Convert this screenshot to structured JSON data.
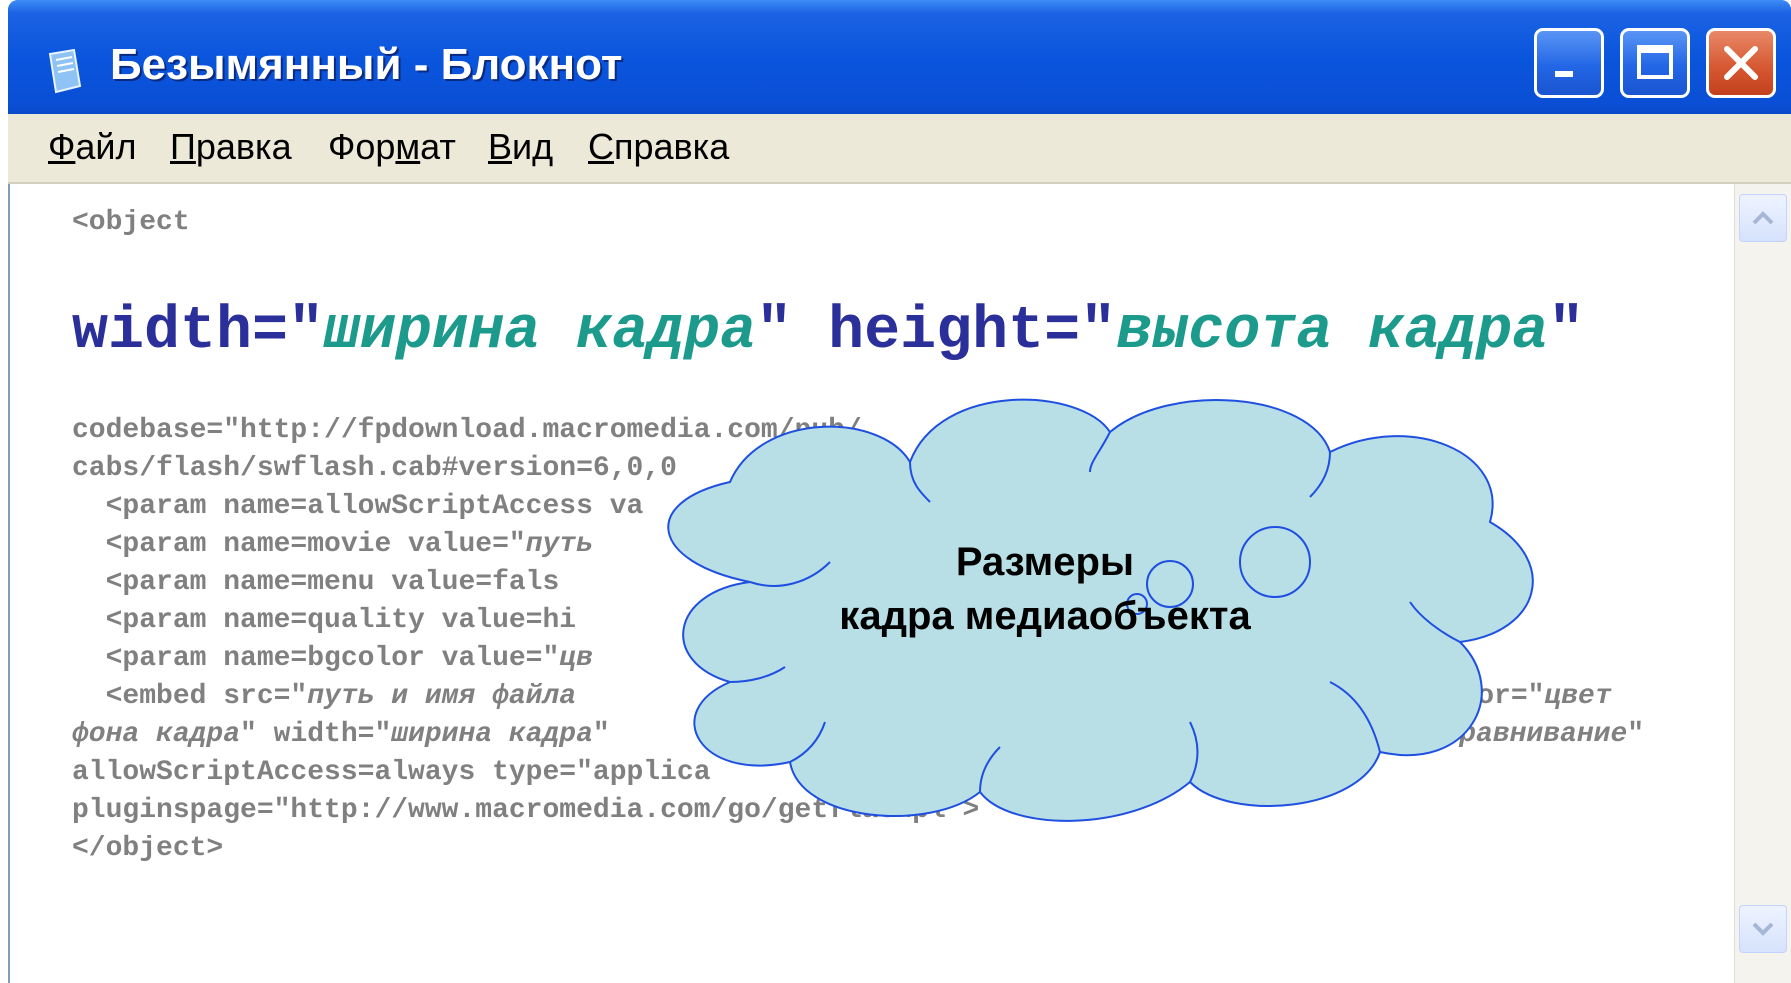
{
  "window": {
    "title": "Безымянный - Блокнот",
    "controls": [
      "minimize",
      "maximize",
      "close"
    ]
  },
  "menu": [
    {
      "label": "Файл",
      "accel": "Ф",
      "rest": "айл"
    },
    {
      "label": "Правка",
      "accel": "П",
      "rest": "равка"
    },
    {
      "label": "Формат",
      "pre": "Фор",
      "accel": "м",
      "rest": "ат"
    },
    {
      "label": "Вид",
      "accel": "В",
      "rest": "ид"
    },
    {
      "label": "Справка",
      "accel": "С",
      "rest": "правка"
    }
  ],
  "editor": {
    "line_object_open": "<object",
    "big_line": {
      "width_attr": "width=\"",
      "width_value": "ширина кадра",
      "height_attr": "\" height=\"",
      "height_value": "высота кадра",
      "end_quote": "\""
    },
    "lines": [
      {
        "id": "l1",
        "parts": [
          {
            "t": "codebase=\"http://fpdownload.macromedia.com/pub/"
          }
        ]
      },
      {
        "id": "l2",
        "parts": [
          {
            "t": "cabs/flash/swflash.cab#version=6,0,0"
          }
        ]
      },
      {
        "id": "l3",
        "parts": [
          {
            "t": "  <param name=allowScriptAccess va"
          }
        ]
      },
      {
        "id": "l4",
        "parts": [
          {
            "t": "  <param name=movie value=\""
          },
          {
            "t": "путь",
            "i": true
          }
        ]
      },
      {
        "id": "l5",
        "parts": [
          {
            "t": "  <param name=menu value=fals"
          }
        ]
      },
      {
        "id": "l6",
        "parts": [
          {
            "t": "  <param name=quality value=hi"
          }
        ]
      },
      {
        "id": "l7",
        "parts": [
          {
            "t": "  <param name=bgcolor value=\""
          },
          {
            "t": "цв",
            "i": true
          }
        ]
      },
      {
        "id": "l8a",
        "parts": [
          {
            "t": "  <embed src=\""
          },
          {
            "t": "путь и имя файла",
            "i": true
          }
        ]
      },
      {
        "id": "l8b",
        "parts": [
          {
            "t": "gcolor=\""
          },
          {
            "t": "цвет",
            "i": true
          }
        ]
      },
      {
        "id": "l9a",
        "parts": [
          {
            "t": "фона кадра",
            "i": true
          },
          {
            "t": "\" width=\""
          },
          {
            "t": "ширина кадра",
            "i": true
          },
          {
            "t": "\""
          }
        ]
      },
      {
        "id": "l9b",
        "parts": [
          {
            "t": "=\""
          },
          {
            "t": "выравнивание",
            "i": true
          },
          {
            "t": "\""
          }
        ]
      },
      {
        "id": "l10a",
        "parts": [
          {
            "t": "allowScriptAccess=always type=\"applica"
          }
        ]
      },
      {
        "id": "l10b",
        "parts": [
          {
            "t": "\""
          }
        ]
      },
      {
        "id": "l11",
        "parts": [
          {
            "t": "pluginspage=\"http://www.macromedia.com/go/getflashpl"
          },
          {
            "t": " >"
          }
        ]
      },
      {
        "id": "l12",
        "parts": [
          {
            "t": "</object>"
          }
        ]
      }
    ]
  },
  "callout": {
    "line1": "Размеры",
    "line2": "кадра медиаобъекта",
    "fill": "#b9dfe6",
    "stroke": "#1f4fe0"
  },
  "colors": {
    "titlebar": "#0a55dd",
    "menubar": "#ece9d8",
    "code_gray": "#808080",
    "attr_blue": "#2b2f9a",
    "value_teal": "#1c9a8c"
  }
}
